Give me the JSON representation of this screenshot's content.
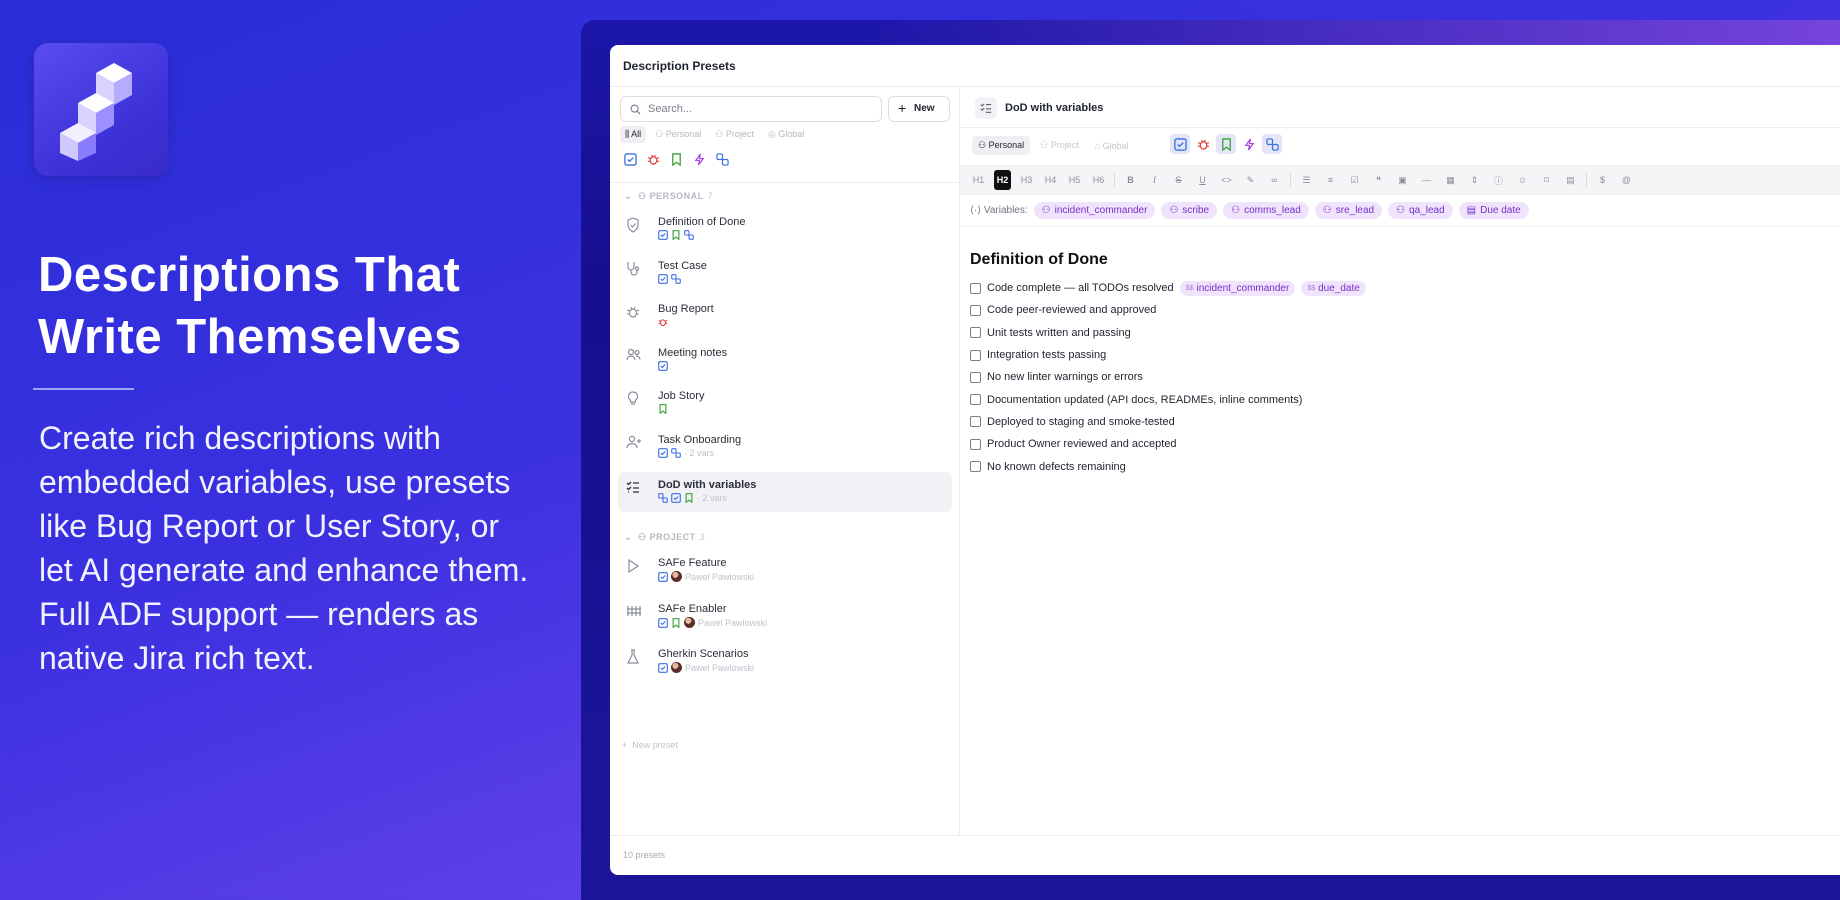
{
  "marketing": {
    "headline": "Descriptions That Write Themselves",
    "body": "Create rich descriptions with embedded variables, use presets like Bug Report or User Story, or let AI generate and enhance them. Full ADF support — renders as native Jira rich text."
  },
  "app": {
    "title": "Description Presets",
    "footer": "10 presets"
  },
  "sidebar": {
    "search_placeholder": "Search...",
    "new_label": "New",
    "filters": [
      "All",
      "Personal",
      "Project",
      "Global"
    ],
    "type_icons": [
      "checkbox-icon",
      "bug-icon",
      "bookmark-icon",
      "lightning-icon",
      "subtask-icon"
    ],
    "sections": [
      {
        "label": "PERSONAL",
        "count": "7"
      },
      {
        "label": "PROJECT",
        "count": "3"
      }
    ],
    "personal_items": [
      {
        "name": "Definition of Done",
        "icon": "shield-check-icon",
        "meta": ""
      },
      {
        "name": "Test Case",
        "icon": "stethoscope-icon",
        "meta": ""
      },
      {
        "name": "Bug Report",
        "icon": "bug-icon",
        "meta": ""
      },
      {
        "name": "Meeting notes",
        "icon": "people-icon",
        "meta": ""
      },
      {
        "name": "Job Story",
        "icon": "lightbulb-icon",
        "meta": ""
      },
      {
        "name": "Task Onboarding",
        "icon": "user-plus-icon",
        "meta": "· 2 vars"
      },
      {
        "name": "DoD with variables",
        "icon": "list-check-icon",
        "meta": "· 2 vars"
      }
    ],
    "project_items": [
      {
        "name": "SAFe Feature",
        "icon": "play-icon",
        "user": "Pawel Pawlowski"
      },
      {
        "name": "SAFe Enabler",
        "icon": "fence-icon",
        "user": "Pawel Pawlowski"
      },
      {
        "name": "Gherkin Scenarios",
        "icon": "flask-icon",
        "user": "Pawel Pawlowski"
      }
    ],
    "new_preset": "New preset"
  },
  "editor": {
    "preset_name": "DoD with variables",
    "scopes": [
      "Personal",
      "Project",
      "Global"
    ],
    "toolbar": [
      "H1",
      "H2",
      "H3",
      "H4",
      "H5",
      "H6"
    ],
    "variables_label": "Variables:",
    "variables": [
      "incident_commander",
      "scribe",
      "comms_lead",
      "sre_lead",
      "qa_lead",
      "Due date"
    ],
    "doc_title": "Definition of Done",
    "items": [
      "Code complete — all TODOs resolved",
      "Code peer-reviewed and approved",
      "Unit tests written and passing",
      "Integration tests passing",
      "No new linter warnings or errors",
      "Documentation updated (API docs, READMEs, inline comments)",
      "Deployed to staging and smoke-tested",
      "Product Owner reviewed and accepted",
      "No known defects remaining"
    ],
    "inline_vars": [
      "incident_commander",
      "due_date"
    ],
    "inline_var_prefix": "$$"
  },
  "colors": {
    "accent": "#3b3fe0",
    "chip_bg": "#efe4fb",
    "chip_text": "#7a2fc9"
  }
}
